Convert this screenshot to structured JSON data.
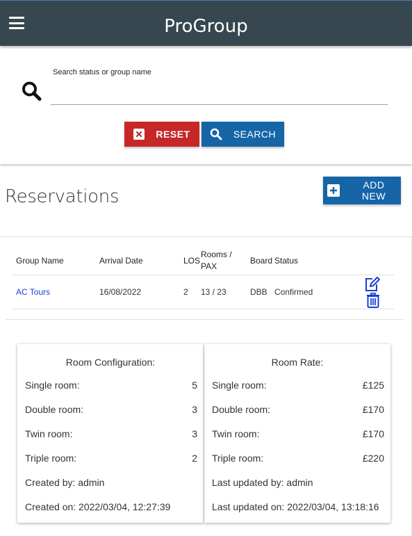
{
  "app": {
    "title": "ProGroup"
  },
  "search": {
    "label": "Search status or group name",
    "value": "",
    "placeholder": "",
    "reset_label": "RESET",
    "search_label": "SEARCH"
  },
  "reservations": {
    "title": "Reservations",
    "add_label": "ADD NEW",
    "headers": {
      "group_name": "Group Name",
      "arrival_date": "Arrival Date",
      "los": "LOS",
      "rooms_pax_1": "Rooms /",
      "rooms_pax_2": "PAX",
      "board": "Board",
      "status": "Status"
    },
    "rows": [
      {
        "group_name": "AC Tours",
        "arrival_date": "16/08/2022",
        "los": "2",
        "rooms_pax": "13 / 23",
        "board": "DBB",
        "status": "Confirmed"
      }
    ]
  },
  "room_configuration": {
    "title": "Room Configuration:",
    "items": [
      {
        "label": "Single room:",
        "value": "5"
      },
      {
        "label": "Double room:",
        "value": "3"
      },
      {
        "label": "Twin room:",
        "value": "3"
      },
      {
        "label": "Triple room:",
        "value": "2"
      }
    ],
    "created_by": "Created by: admin",
    "created_on": "Created on: 2022/03/04, 12:27:39"
  },
  "room_rate": {
    "title": "Room Rate:",
    "items": [
      {
        "label": "Single room:",
        "value": "£125"
      },
      {
        "label": "Double room:",
        "value": "£170"
      },
      {
        "label": "Twin room:",
        "value": "£170"
      },
      {
        "label": "Triple room:",
        "value": "£220"
      }
    ],
    "updated_by": "Last updated by: admin",
    "updated_on": "Last updated on: 2022/03/04, 13:18:16"
  },
  "colors": {
    "appbar": "#37474f",
    "reset": "#c62828",
    "primary": "#1565a7",
    "link": "#1a3fd8"
  },
  "icons": {
    "menu": "menu-icon",
    "search": "search-icon",
    "reset": "close-box-icon",
    "add": "plus-box-icon",
    "edit": "edit-icon",
    "delete": "trash-icon"
  }
}
